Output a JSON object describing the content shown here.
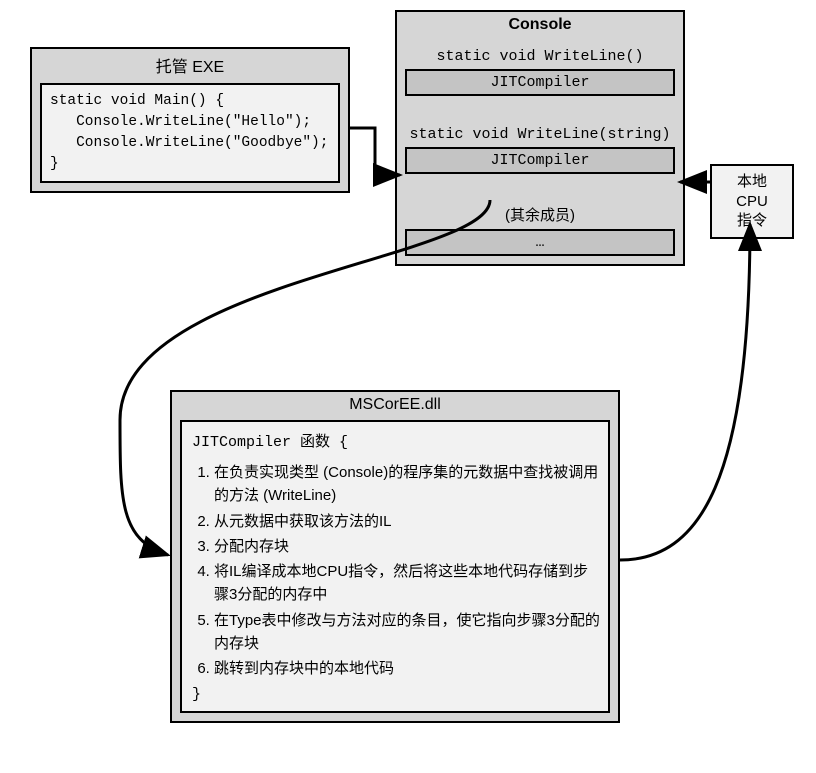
{
  "exe_box": {
    "title": "托管 EXE",
    "code": "static void Main() {\n   Console.WriteLine(\"Hello\");\n   Console.WriteLine(\"Goodbye\");\n}"
  },
  "console_box": {
    "title": "Console",
    "method1": "static void WriteLine()",
    "slot1": "JITCompiler",
    "method2": "static void WriteLine(string)",
    "slot2": "JITCompiler",
    "other_members": "(其余成员)",
    "slot3": "…"
  },
  "cpu_box": {
    "line1": "本地 CPU",
    "line2": "指令"
  },
  "mscoree_box": {
    "title": "MSCorEE.dll",
    "header": "JITCompiler  函数    {",
    "steps": [
      "在负责实现类型 (Console)的程序集的元数据中查找被调用的方法 (WriteLine)",
      "从元数据中获取该方法的IL",
      "分配内存块",
      "将IL编译成本地CPU指令，然后将这些本地代码存储到步骤3分配的内存中",
      "在Type表中修改与方法对应的条目，使它指向步骤3分配的内存块",
      "跳转到内存块中的本地代码"
    ],
    "close": "}"
  }
}
